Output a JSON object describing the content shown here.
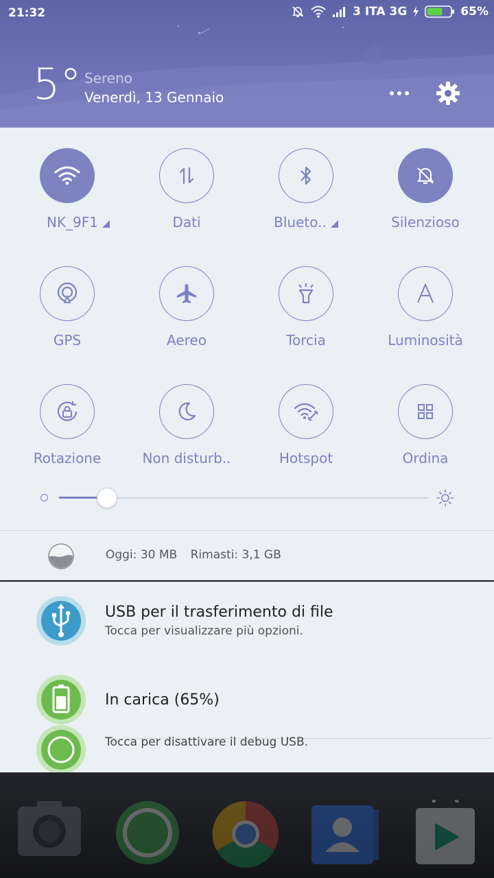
{
  "status_bar": {
    "time": "21:32",
    "carrier": "3 ITA 3G",
    "battery": "65%",
    "icons": [
      "bell-off-icon",
      "wifi-icon",
      "signal-icon",
      "charging-icon",
      "battery-icon"
    ]
  },
  "weather": {
    "temperature": "5°",
    "condition": "Sereno",
    "date": "Venerdì, 13 Gennaio"
  },
  "header_actions": [
    "more-icon",
    "gear-icon"
  ],
  "tiles": [
    {
      "label": "NK_9F1",
      "icon": "wifi-icon",
      "on": true,
      "expand": true
    },
    {
      "label": "Dati",
      "icon": "data-arrows-icon",
      "on": false
    },
    {
      "label": "Blueto..",
      "icon": "bluetooth-icon",
      "on": false,
      "expand": true
    },
    {
      "label": "Silenzioso",
      "icon": "bell-off-icon",
      "on": true
    },
    {
      "label": "GPS",
      "icon": "gps-icon",
      "on": false
    },
    {
      "label": "Aereo",
      "icon": "airplane-icon",
      "on": false
    },
    {
      "label": "Torcia",
      "icon": "flashlight-icon",
      "on": false
    },
    {
      "label": "Luminosità",
      "icon": "auto-brightness-icon",
      "on": false
    },
    {
      "label": "Rotazione",
      "icon": "rotation-lock-icon",
      "on": false
    },
    {
      "label": "Non disturb..",
      "icon": "moon-icon",
      "on": false
    },
    {
      "label": "Hotspot",
      "icon": "hotspot-icon",
      "on": false
    },
    {
      "label": "Ordina",
      "icon": "grid-icon",
      "on": false
    }
  ],
  "brightness": {
    "level": 0.13
  },
  "data_usage": {
    "today": "Oggi: 30 MB",
    "remaining": "Rimasti: 3,1 GB"
  },
  "notifications": [
    {
      "title": "USB per il trasferimento di file",
      "subtitle": "Tocca per visualizzare più opzioni.",
      "icon": "usb-icon"
    },
    {
      "title": "In carica (65%)",
      "subtitle": "",
      "icon": "battery-charging-icon"
    },
    {
      "title": "",
      "subtitle": "Tocca per disattivare il debug USB.",
      "icon": "android-debug-icon"
    }
  ],
  "colors": {
    "accent": "#7d82c1",
    "header": "#6c72b5",
    "panel": "#eaf0f3"
  }
}
